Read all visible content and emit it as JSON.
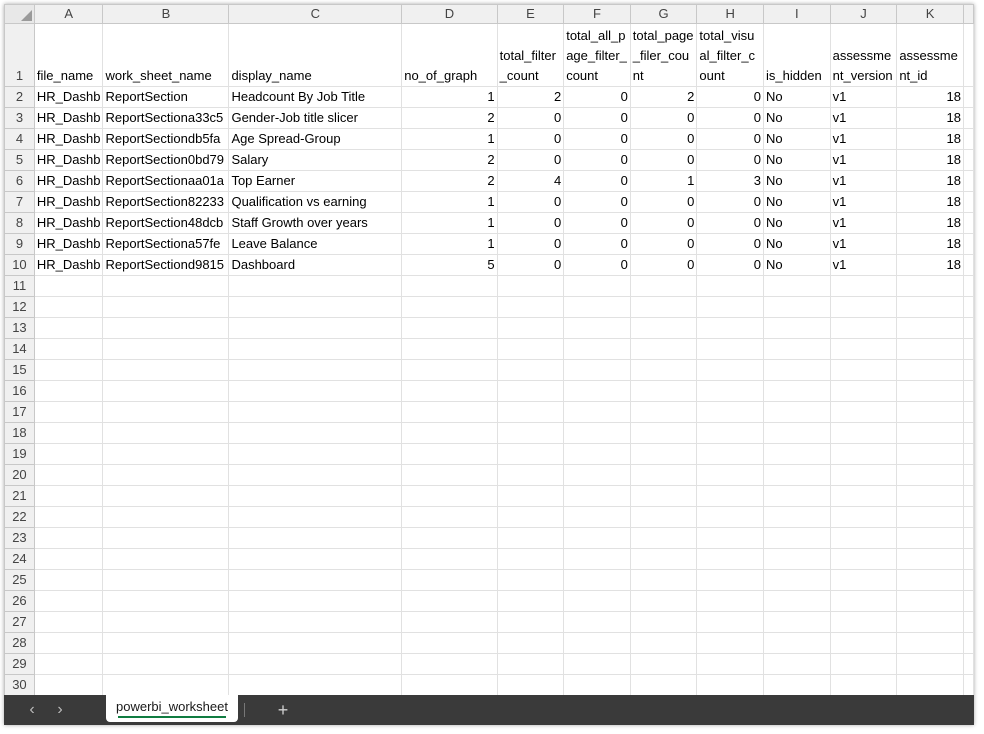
{
  "columns": [
    "A",
    "B",
    "C",
    "D",
    "E",
    "F",
    "G",
    "H",
    "I",
    "J",
    "K"
  ],
  "header_row": {
    "row": "1",
    "cells": [
      "file_name",
      "work_sheet_name",
      "display_name",
      "no_of_graph",
      "total_filter_count",
      "total_all_page_filter_count",
      "total_page_filer_count",
      "total_visual_filter_count",
      "is_hidden",
      "assessment_version",
      "assessment_id"
    ]
  },
  "rows": [
    {
      "row": "2",
      "cells": [
        "HR_Dashb",
        "ReportSection",
        "Headcount By Job Title",
        "1",
        "2",
        "0",
        "2",
        "0",
        "No",
        "v1",
        "18"
      ]
    },
    {
      "row": "3",
      "cells": [
        "HR_Dashb",
        "ReportSectiona33c5",
        "Gender-Job title slicer",
        "2",
        "0",
        "0",
        "0",
        "0",
        "No",
        "v1",
        "18"
      ]
    },
    {
      "row": "4",
      "cells": [
        "HR_Dashb",
        "ReportSectiondb5fa",
        "Age Spread-Group",
        "1",
        "0",
        "0",
        "0",
        "0",
        "No",
        "v1",
        "18"
      ]
    },
    {
      "row": "5",
      "cells": [
        "HR_Dashb",
        "ReportSection0bd79",
        "Salary",
        "2",
        "0",
        "0",
        "0",
        "0",
        "No",
        "v1",
        "18"
      ]
    },
    {
      "row": "6",
      "cells": [
        "HR_Dashb",
        "ReportSectionaa01a",
        "Top Earner",
        "2",
        "4",
        "0",
        "1",
        "3",
        "No",
        "v1",
        "18"
      ]
    },
    {
      "row": "7",
      "cells": [
        "HR_Dashb",
        "ReportSection82233",
        "Qualification vs earning",
        "1",
        "0",
        "0",
        "0",
        "0",
        "No",
        "v1",
        "18"
      ]
    },
    {
      "row": "8",
      "cells": [
        "HR_Dashb",
        "ReportSection48dcb",
        "Staff Growth over years",
        "1",
        "0",
        "0",
        "0",
        "0",
        "No",
        "v1",
        "18"
      ]
    },
    {
      "row": "9",
      "cells": [
        "HR_Dashb",
        "ReportSectiona57fe",
        "Leave Balance",
        "1",
        "0",
        "0",
        "0",
        "0",
        "No",
        "v1",
        "18"
      ]
    },
    {
      "row": "10",
      "cells": [
        "HR_Dashb",
        "ReportSectiond9815",
        "Dashboard",
        "5",
        "0",
        "0",
        "0",
        "0",
        "No",
        "v1",
        "18"
      ]
    }
  ],
  "empty_rows": [
    "11",
    "12",
    "13",
    "14",
    "15",
    "16",
    "17",
    "18",
    "19",
    "20",
    "21",
    "22",
    "23",
    "24",
    "25",
    "26",
    "27",
    "28",
    "29",
    "30"
  ],
  "tabs": {
    "prev_icon": "‹",
    "next_icon": "›",
    "active_sheet": "powerbi_worksheet",
    "add_icon": "+"
  },
  "colors": {
    "tabbar_bg": "#3a3a3a",
    "active_tab_underline": "#107c41",
    "header_bg": "#f0f0f0"
  }
}
